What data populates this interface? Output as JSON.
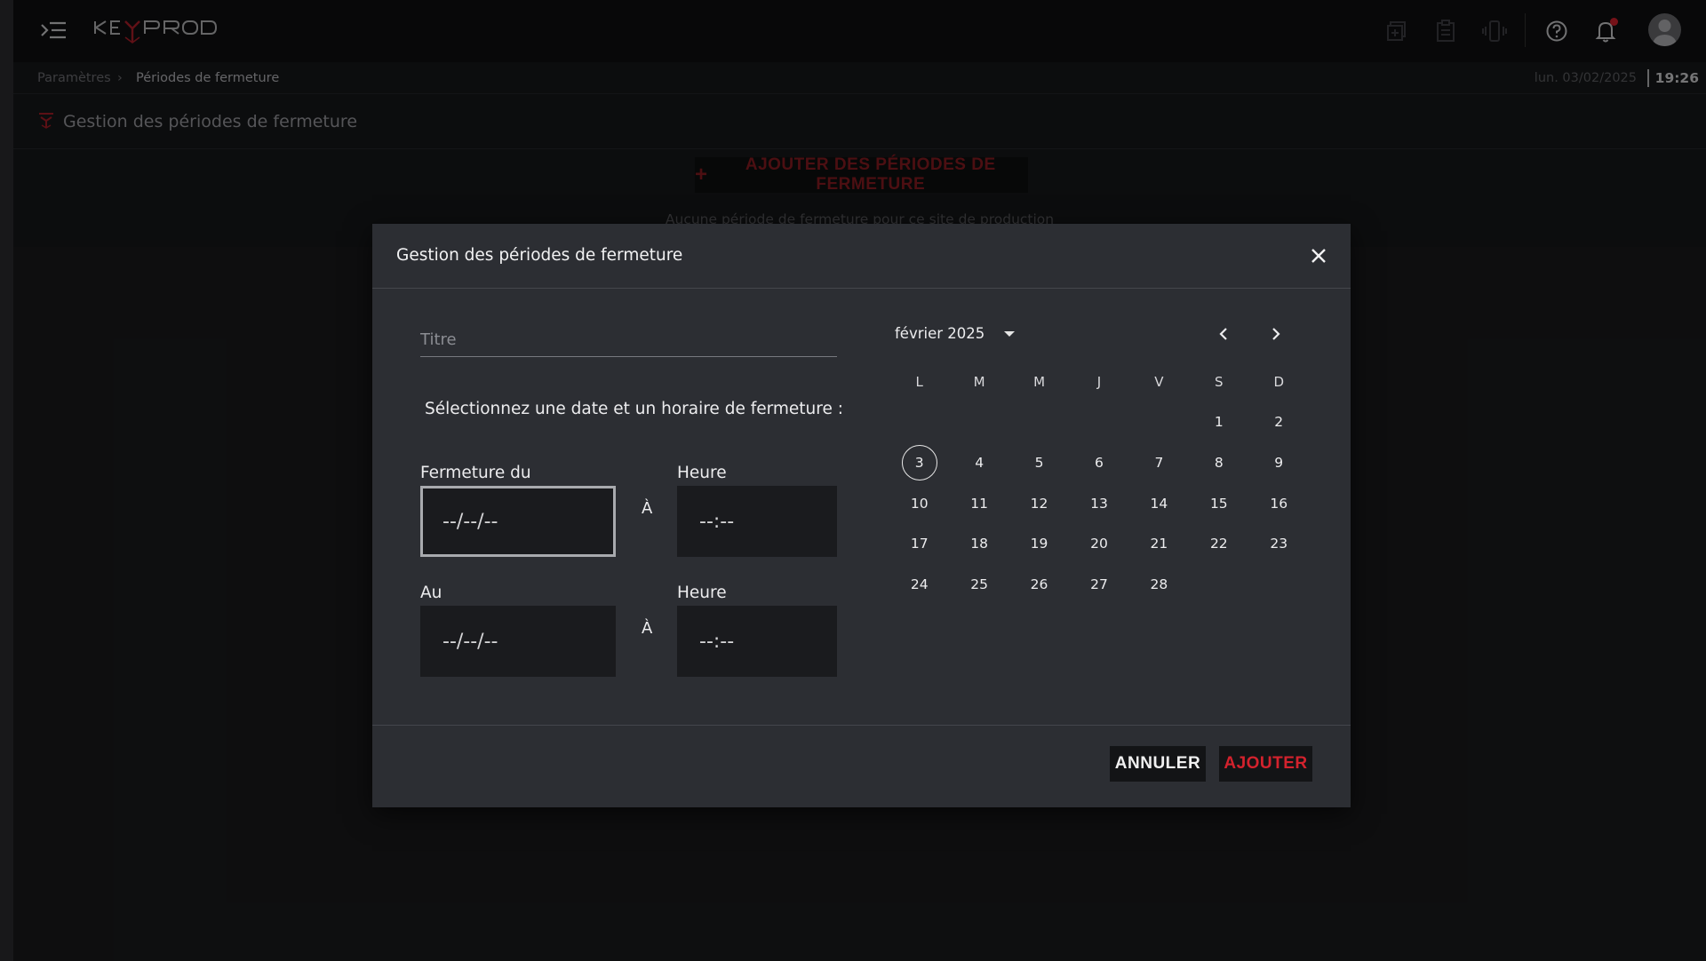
{
  "app": {
    "logo_text": "KEYPROD",
    "accent_color": "#d6202c"
  },
  "topbar": {
    "icons": [
      "add-window-icon",
      "clipboard-icon",
      "phone-vibrate-icon",
      "help-icon",
      "bell-icon",
      "user-avatar"
    ]
  },
  "breadcrumb": {
    "parent": "Paramètres",
    "separator": "›",
    "current": "Périodes de fermeture"
  },
  "clock": {
    "date": "lun. 03/02/2025",
    "time": "19:26"
  },
  "page": {
    "title": "Gestion des périodes de fermeture",
    "add_button_label": "AJOUTER DES PÉRIODES DE FERMETURE",
    "add_button_icon": "+",
    "empty_message": "Aucune période de fermeture pour ce site de production"
  },
  "modal": {
    "title": "Gestion des périodes de fermeture",
    "title_placeholder": "Titre",
    "instruction": "Sélectionnez une date et un horaire de fermeture :",
    "from_label": "Fermeture du",
    "to_label": "Au",
    "hour_label": "Heure",
    "a_label": "À",
    "date_value": "--/--/--",
    "time_value": "--:--",
    "cancel_label": "ANNULER",
    "add_label": "AJOUTER"
  },
  "calendar": {
    "month_label": "février 2025",
    "weekdays": [
      "L",
      "M",
      "M",
      "J",
      "V",
      "S",
      "D"
    ],
    "weeks": [
      [
        "",
        "",
        "",
        "",
        "",
        "1",
        "2"
      ],
      [
        "3",
        "4",
        "5",
        "6",
        "7",
        "8",
        "9"
      ],
      [
        "10",
        "11",
        "12",
        "13",
        "14",
        "15",
        "16"
      ],
      [
        "17",
        "18",
        "19",
        "20",
        "21",
        "22",
        "23"
      ],
      [
        "24",
        "25",
        "26",
        "27",
        "28",
        "",
        ""
      ]
    ],
    "today": "3"
  }
}
